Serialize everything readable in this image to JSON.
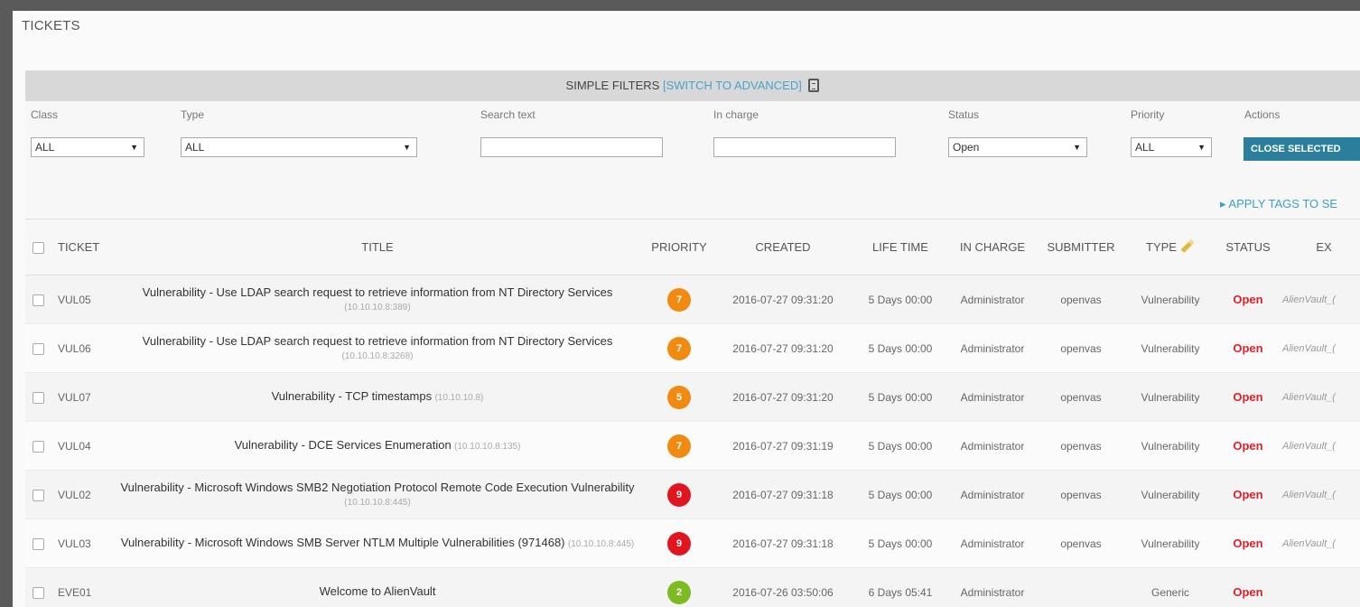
{
  "page": {
    "title": "TICKETS"
  },
  "filters": {
    "header_label": "SIMPLE FILTERS",
    "switch_label": "[SWITCH TO ADVANCED]",
    "class": {
      "label": "Class",
      "value": "ALL"
    },
    "type": {
      "label": "Type",
      "value": "ALL"
    },
    "search": {
      "label": "Search text",
      "value": ""
    },
    "in_charge": {
      "label": "In charge",
      "value": ""
    },
    "status": {
      "label": "Status",
      "value": "Open"
    },
    "priority": {
      "label": "Priority",
      "value": "ALL"
    },
    "actions": {
      "label": "Actions",
      "button": "CLOSE SELECTED"
    },
    "apply_tags": "▸ APPLY TAGS TO SE"
  },
  "table": {
    "columns": {
      "ticket": "TICKET",
      "title": "TITLE",
      "priority": "PRIORITY",
      "created": "CREATED",
      "life_time": "LIFE TIME",
      "in_charge": "IN CHARGE",
      "submitter": "SUBMITTER",
      "type": "TYPE",
      "status": "STATUS",
      "extra": "EX"
    },
    "rows": [
      {
        "ticket": "VUL05",
        "title": "Vulnerability - Use LDAP search request to retrieve information from NT Directory Services",
        "ip": "(10.10.10.8:389)",
        "priority": "7",
        "priority_color": "#f08a10",
        "created": "2016-07-27 09:31:20",
        "life_time": "5 Days 00:00",
        "in_charge": "Administrator",
        "submitter": "openvas",
        "type": "Vulnerability",
        "status": "Open",
        "extra": "AlienVault_("
      },
      {
        "ticket": "VUL06",
        "title": "Vulnerability - Use LDAP search request to retrieve information from NT Directory Services",
        "ip": "(10.10.10.8:3268)",
        "priority": "7",
        "priority_color": "#f08a10",
        "created": "2016-07-27 09:31:20",
        "life_time": "5 Days 00:00",
        "in_charge": "Administrator",
        "submitter": "openvas",
        "type": "Vulnerability",
        "status": "Open",
        "extra": "AlienVault_("
      },
      {
        "ticket": "VUL07",
        "title": "Vulnerability - TCP timestamps",
        "ip": "(10.10.10.8)",
        "priority": "5",
        "priority_color": "#f08a10",
        "created": "2016-07-27 09:31:20",
        "life_time": "5 Days 00:00",
        "in_charge": "Administrator",
        "submitter": "openvas",
        "type": "Vulnerability",
        "status": "Open",
        "extra": "AlienVault_("
      },
      {
        "ticket": "VUL04",
        "title": "Vulnerability - DCE Services Enumeration",
        "ip": "(10.10.10.8:135)",
        "priority": "7",
        "priority_color": "#f08a10",
        "created": "2016-07-27 09:31:19",
        "life_time": "5 Days 00:00",
        "in_charge": "Administrator",
        "submitter": "openvas",
        "type": "Vulnerability",
        "status": "Open",
        "extra": "AlienVault_("
      },
      {
        "ticket": "VUL02",
        "title": "Vulnerability - Microsoft Windows SMB2 Negotiation Protocol Remote Code Execution Vulnerability",
        "ip": "(10.10.10.8:445)",
        "priority": "9",
        "priority_color": "#e0151f",
        "created": "2016-07-27 09:31:18",
        "life_time": "5 Days 00:00",
        "in_charge": "Administrator",
        "submitter": "openvas",
        "type": "Vulnerability",
        "status": "Open",
        "extra": "AlienVault_("
      },
      {
        "ticket": "VUL03",
        "title": "Vulnerability - Microsoft Windows SMB Server NTLM Multiple Vulnerabilities (971468)",
        "ip": "(10.10.10.8:445)",
        "priority": "9",
        "priority_color": "#e0151f",
        "created": "2016-07-27 09:31:18",
        "life_time": "5 Days 00:00",
        "in_charge": "Administrator",
        "submitter": "openvas",
        "type": "Vulnerability",
        "status": "Open",
        "extra": "AlienVault_("
      },
      {
        "ticket": "EVE01",
        "title": "Welcome to AlienVault",
        "ip": "",
        "priority": "2",
        "priority_color": "#7cbb22",
        "created": "2016-07-26 03:50:06",
        "life_time": "6 Days 05:41",
        "in_charge": "Administrator",
        "submitter": "",
        "type": "Generic",
        "status": "Open",
        "extra": ""
      }
    ]
  }
}
